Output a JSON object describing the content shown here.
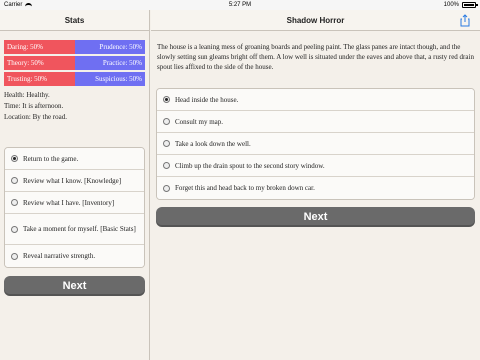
{
  "status_bar": {
    "carrier": "Carrier",
    "time": "5:27 PM",
    "battery": "100%"
  },
  "stats_pane": {
    "title": "Stats",
    "stats": [
      {
        "left": "Daring: 50%",
        "right": "Prudence: 50%"
      },
      {
        "left": "Theory: 50%",
        "right": "Practice: 50%"
      },
      {
        "left": "Trusting: 50%",
        "right": "Suspicious: 50%"
      }
    ],
    "info": [
      "Health: Healthy.",
      "Time: It is afternoon.",
      "Location: By the road."
    ],
    "choices": [
      {
        "label": "Return to the game.",
        "selected": true
      },
      {
        "label": "Review what I know. [Knowledge]",
        "selected": false
      },
      {
        "label": "Review what I have. [Inventory]",
        "selected": false
      },
      {
        "label": "Take a moment for myself. [Basic Stats]",
        "selected": false
      },
      {
        "label": "Reveal narrative strength.",
        "selected": false
      }
    ],
    "next_label": "Next"
  },
  "story_pane": {
    "title": "Shadow Horror",
    "narrative": "The house is a leaning mess of groaning boards and peeling paint. The glass panes are intact though, and the slowly setting sun gleams bright off them. A low well is situated under the eaves and above that, a rusty red drain spout lies affixed to the side of the house.",
    "choices": [
      {
        "label": "Head inside the house.",
        "selected": true
      },
      {
        "label": "Consult my map.",
        "selected": false
      },
      {
        "label": "Take a look down the well.",
        "selected": false
      },
      {
        "label": "Climb up the drain spout to the second story window.",
        "selected": false
      },
      {
        "label": "Forget this and head back to my broken down car.",
        "selected": false
      }
    ],
    "next_label": "Next"
  },
  "colors": {
    "stat_left": "#f0555d",
    "stat_right": "#6f6ff2",
    "button": "#6a6a6a",
    "background": "#f4f0ea"
  }
}
